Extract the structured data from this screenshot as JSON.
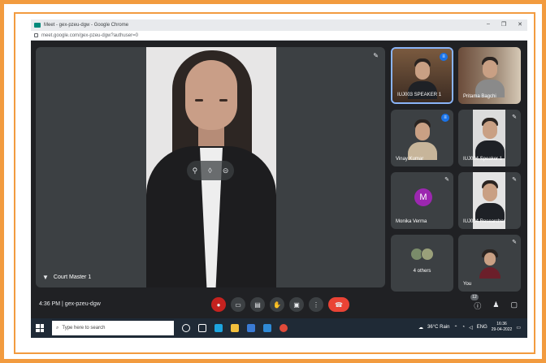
{
  "browser": {
    "tab_title": "Meet - gex-pzeu-dgw - Google Chrome",
    "url": "meet.google.com/gex-pzeu-dgw?authuser=0",
    "win_min": "–",
    "win_max": "❐",
    "win_close": "✕"
  },
  "main_speaker": {
    "name": "Court Master 1"
  },
  "participants": [
    {
      "name": "IUJ003 SPEAKER 1",
      "speaking": true
    },
    {
      "name": "Pritama Bagchi",
      "speaking": false
    },
    {
      "name": "Vinay Kumar",
      "speaking": true
    },
    {
      "name": "IUJ004 Speaker 1",
      "speaking": false
    },
    {
      "name": "Monika Verma",
      "avatar_letter": "M",
      "avatar_color": "#9c27b0"
    },
    {
      "name": "IUJ004 Researcher",
      "speaking": false
    },
    {
      "name": "4 others"
    },
    {
      "name": "You"
    }
  ],
  "meeting": {
    "time": "4:36 PM",
    "code": "gex-pzeu-dgw",
    "participant_count": "12"
  },
  "taskbar": {
    "search_placeholder": "Type here to search",
    "weather": "36°C  Rain",
    "lang": "ENG",
    "clock_time": "16:36",
    "clock_date": "29-04-2022"
  },
  "colors": {
    "frame": "#f29b3f",
    "meet_bg": "#202124",
    "tile_bg": "#3c4043",
    "end_call": "#ea4335",
    "speaking": "#1a73e8"
  }
}
